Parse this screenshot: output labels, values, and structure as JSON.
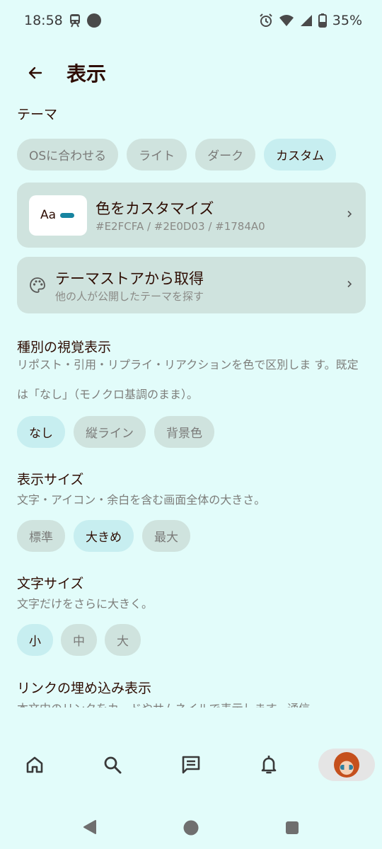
{
  "status_bar": {
    "time": "18:58",
    "battery": "35%",
    "icons": [
      "train-icon",
      "circle-icon",
      "alarm-icon",
      "wifi-icon",
      "signal-icon",
      "battery-icon"
    ]
  },
  "header": {
    "back_icon": "arrow-left-icon",
    "title": "表示"
  },
  "theme": {
    "title": "テーマ",
    "options": [
      "OSに合わせる",
      "ライト",
      "ダーク",
      "カスタム"
    ],
    "selected": "カスタム"
  },
  "customize_card": {
    "preview_text": "Aa",
    "title": "色をカスタマイズ",
    "colors": "#E2FCFA / #2E0D03 / #1784A0",
    "chevron_icon": "chevron-right-icon"
  },
  "theme_store_card": {
    "icon": "palette-icon",
    "title": "テーマストアから取得",
    "subtitle": "他の人が公開したテーマを探す",
    "chevron_icon": "chevron-right-icon"
  },
  "type_visual": {
    "title": "種別の視覚表示",
    "desc": "リポスト・引用・リプライ・リアクションを色で区別しま す。既定は「なし」（モノクロ基調のまま）。",
    "options": [
      "なし",
      "縦ライン",
      "背景色"
    ],
    "selected": "なし"
  },
  "display_size": {
    "title": "表示サイズ",
    "desc": "文字・アイコン・余白を含む画面全体の大きさ。",
    "options": [
      "標準",
      "大きめ",
      "最大"
    ],
    "selected": "大きめ"
  },
  "font_size": {
    "title": "文字サイズ",
    "desc": "文字だけをさらに大きく。",
    "options": [
      "小",
      "中",
      "大"
    ],
    "selected": "小"
  },
  "link_embed": {
    "title": "リンクの埋め込み表示",
    "desc": "本文中のリンクをカードやサムネイルで表示します。通信"
  },
  "bottom_nav": {
    "items": [
      "home-icon",
      "search-icon",
      "messages-icon",
      "notifications-icon",
      "avatar"
    ]
  },
  "colors": {
    "background": "#E2FCFA",
    "text": "#2E0D03",
    "accent": "#1784A0",
    "chip": "#CFE3DE",
    "chip_selected": "#C7EEF0"
  }
}
